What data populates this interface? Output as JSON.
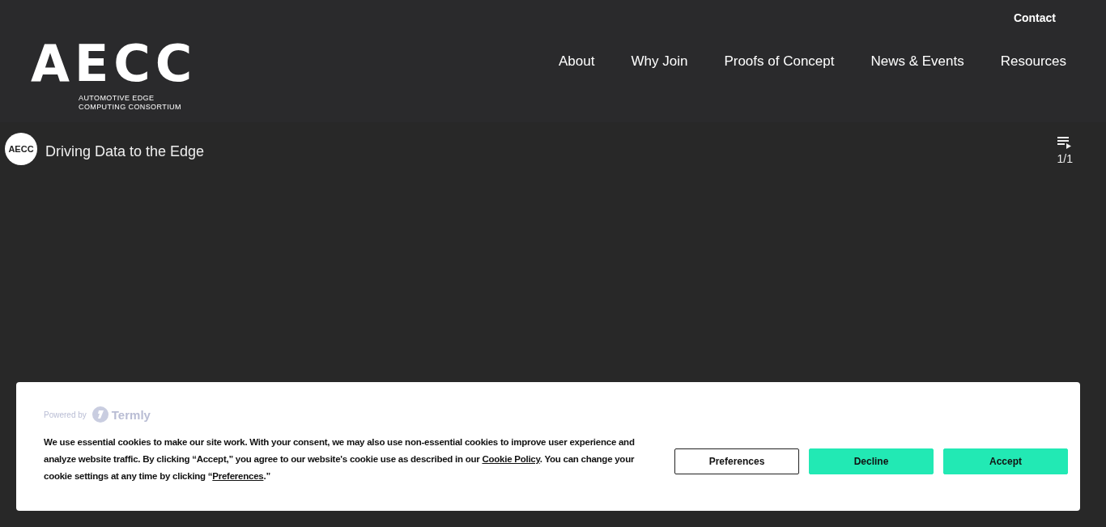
{
  "header": {
    "contact": "Contact",
    "logo": {
      "mark": "AECC",
      "tagline": [
        "AUTOMOTIVE EDGE",
        "COMPUTING CONSORTIUM"
      ]
    },
    "nav": [
      "About",
      "Why Join",
      "Proofs of Concept",
      "News & Events",
      "Resources"
    ]
  },
  "video": {
    "channel_logo": "AECC",
    "title": "Driving Data to the Edge",
    "playlist_count": "1/1",
    "kind": "picture"
  },
  "cookie_banner": {
    "powered_by": "Powered by",
    "brand": "Termly",
    "message": [
      {
        "kind": "text",
        "text": "We use essential cookies to make our site work. With your consent, we may also use non-essential cookies to improve user experience and analyze website traffic. By clicking “Accept,” you agree to our website's cookie use as described in our "
      },
      {
        "kind": "link",
        "text": "Cookie Policy"
      },
      {
        "kind": "text",
        "text": ". You can change your cookie settings at any time by clicking “"
      },
      {
        "kind": "link",
        "text": "Preferences"
      },
      {
        "kind": "text",
        "text": ".”"
      }
    ],
    "buttons": [
      {
        "label": "Preferences",
        "kind": "outline"
      },
      {
        "label": "Decline",
        "kind": "filled"
      },
      {
        "label": "Accept",
        "kind": "filled"
      }
    ]
  }
}
